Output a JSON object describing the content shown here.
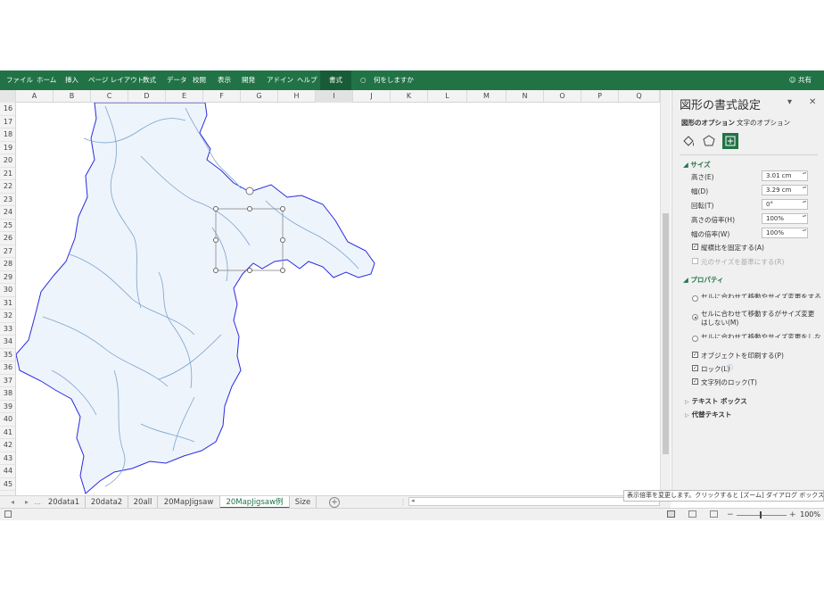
{
  "ribbon": {
    "tabs": [
      "ファイル",
      "ホーム",
      "挿入",
      "ページ レイアウト",
      "数式",
      "データ",
      "校閲",
      "表示",
      "開発",
      "アドイン",
      "ヘルプ",
      "書式"
    ],
    "active_tab": "書式",
    "tell_me": "何をしますか",
    "share": "共有"
  },
  "columns": [
    "A",
    "B",
    "C",
    "D",
    "E",
    "F",
    "G",
    "H",
    "I",
    "J",
    "K",
    "L",
    "M",
    "N",
    "O",
    "P",
    "Q"
  ],
  "rows": [
    "16",
    "17",
    "18",
    "19",
    "20",
    "21",
    "22",
    "23",
    "24",
    "25",
    "26",
    "27",
    "28",
    "29",
    "30",
    "31",
    "32",
    "33",
    "34",
    "35",
    "36",
    "37",
    "38",
    "39",
    "40",
    "41",
    "42",
    "43",
    "44",
    "45"
  ],
  "sheet_tabs": {
    "tabs": [
      "20data1",
      "20data2",
      "20all",
      "20MapJigsaw",
      "20MapJigsaw例",
      "Size"
    ],
    "active": "20MapJigsaw例"
  },
  "status": {
    "zoom": "100%",
    "tooltip": "表示倍率を変更します。クリックすると [ズーム] ダイアログ ボックスが開きます。"
  },
  "pane": {
    "title": "図形の書式設定",
    "tabs": [
      "図形のオプション",
      "文字のオプション"
    ],
    "size_section": "サイズ",
    "height_label": "高さ(E)",
    "height_value": "3.01 cm",
    "width_label": "幅(D)",
    "width_value": "3.29 cm",
    "rotation_label": "回転(T)",
    "rotation_value": "0°",
    "scale_h_label": "高さの倍率(H)",
    "scale_h_value": "100%",
    "scale_w_label": "幅の倍率(W)",
    "scale_w_value": "100%",
    "lock_ratio": "縦横比を固定する(A)",
    "original_size": "元のサイズを基準にする(R)",
    "props_section": "プロパティ",
    "prop_move_size": "セルに合わせて移動やサイズ変更をする(S)",
    "prop_move_only": "セルに合わせて移動するがサイズ変更はしない(M)",
    "prop_none": "セルに合わせて移動やサイズ変更をしない(D)",
    "print_object": "オブジェクトを印刷する(P)",
    "lock": "ロック(L)",
    "lock_text": "文字列のロック(T)",
    "textbox": "テキスト ボックス",
    "alt_text": "代替テキスト"
  },
  "colors": {
    "accent": "#217346",
    "map_fill": "#eef4fb",
    "border": "#2a2ae0",
    "river": "#7aa3cf"
  }
}
